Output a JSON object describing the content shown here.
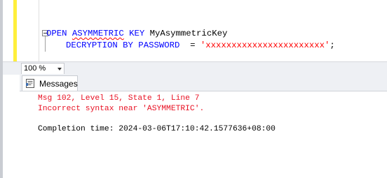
{
  "editor": {
    "line1": {
      "kw_open": "OPEN",
      "kw_asymmetric": "ASYMMETRIC",
      "kw_key": "KEY",
      "name": "MyAsymmetricKey"
    },
    "line2": {
      "kw_decryption": "DECRYPTION BY PASSWORD",
      "equals": "=",
      "password": "'xxxxxxxxxxxxxxxxxxxxxxx'",
      "semicolon": ";"
    }
  },
  "zoom": {
    "value": "100 %"
  },
  "results": {
    "tab_label": "Messages",
    "messages": {
      "error_line1": "Msg 102, Level 15, State 1, Line 7",
      "error_line2": "Incorrect syntax near 'ASYMMETRIC'.",
      "completion": "Completion time: 2024-03-06T17:10:42.1577636+08:00"
    }
  },
  "colors": {
    "keyword": "#0000ff",
    "string": "#ff0000",
    "error": "#e81123",
    "modified_bar": "#ffef3b"
  },
  "icons": {
    "collapse": "outline-collapse-icon",
    "messages": "messages-icon",
    "dropdown": "chevron-down-icon"
  }
}
